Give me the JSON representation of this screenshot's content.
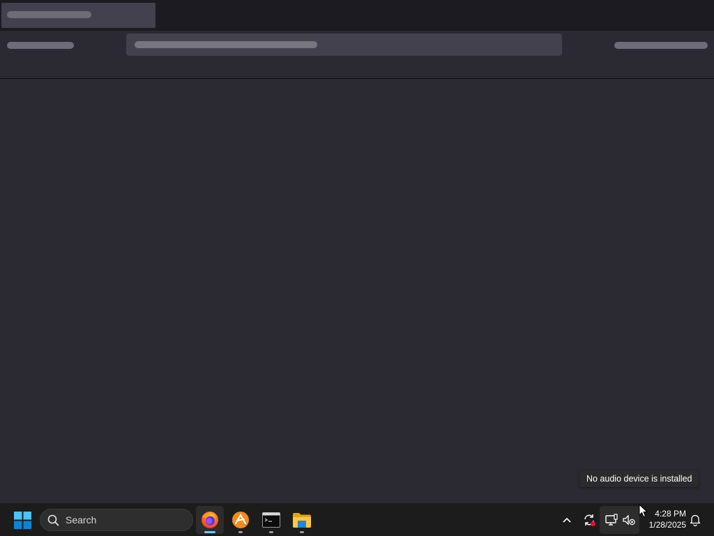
{
  "notification": {
    "text": "No audio device is installed"
  },
  "taskbar": {
    "search_label": "Search",
    "apps": [
      {
        "name": "Firefox",
        "icon": "firefox-icon",
        "active": true
      },
      {
        "name": "App",
        "icon": "orange-app-icon",
        "active": false
      },
      {
        "name": "Terminal",
        "icon": "terminal-icon",
        "active": false
      },
      {
        "name": "File Explorer",
        "icon": "folder-icon",
        "active": false
      }
    ],
    "tray_icons": [
      "chevron-up-icon",
      "sync-icon",
      "network-icon",
      "speaker-muted-icon"
    ],
    "clock": {
      "time": "4:28 PM",
      "date": "1/28/2025"
    }
  },
  "colors": {
    "accent": "#60cdff",
    "chrome_bg": "#1c1b22",
    "content_bg": "#2b2a33",
    "taskbar_bg": "#1c1c1c"
  }
}
